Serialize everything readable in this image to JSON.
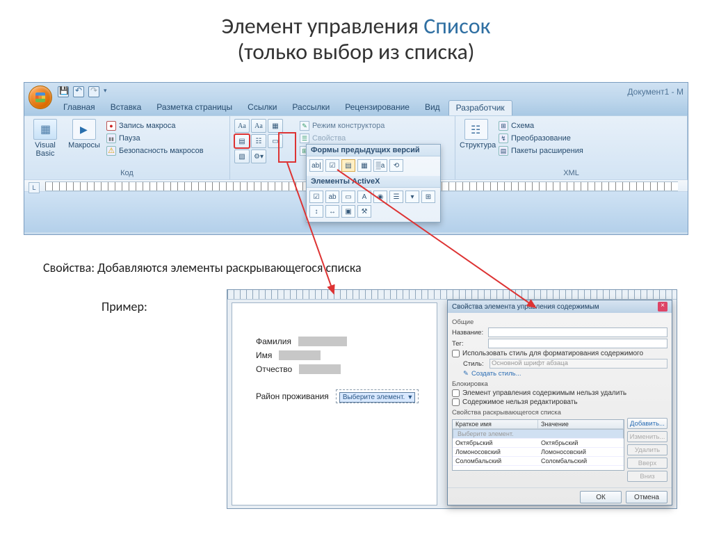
{
  "slide": {
    "title_plain": "Элемент управления ",
    "title_accent": "Список",
    "subtitle": "(только выбор из списка)"
  },
  "word": {
    "doc_title": "Документ1 - M",
    "tabs": [
      "Главная",
      "Вставка",
      "Разметка страницы",
      "Ссылки",
      "Рассылки",
      "Рецензирование",
      "Вид",
      "Разработчик"
    ],
    "active_tab_index": 7,
    "groups": {
      "code": {
        "label": "Код",
        "vb": "Visual Basic",
        "macros": "Макросы",
        "rec": "Запись макроса",
        "pause": "Пауза",
        "security": "Безопасность макросов"
      },
      "controls": {
        "design_mode": "Режим конструктора",
        "properties": "Свойства",
        "group": "Группировать"
      },
      "xml": {
        "label": "XML",
        "structure": "Структура",
        "schema": "Схема",
        "transform": "Преобразование",
        "packs": "Пакеты расширения"
      }
    },
    "legacy_panel": {
      "hdr1": "Формы предыдущих версий",
      "hdr2": "Элементы ActiveX"
    }
  },
  "body": {
    "prop_line": "Свойства: Добавляются  элементы раскрывающегося списка",
    "example": "Пример:",
    "form": {
      "lastname": "Фамилия",
      "firstname": "Имя",
      "patronymic": "Отчество",
      "region": "Район проживания",
      "dd_text": "Выберите элемент."
    }
  },
  "dialog": {
    "title": "Свойства элемента управления содержимым",
    "general": "Общие",
    "name": "Название:",
    "tag": "Тег:",
    "use_style": "Использовать стиль для форматирования содержимого",
    "style_lbl": "Стиль:",
    "style_val": "Основной шрифт абзаца",
    "create_style": "Создать стиль...",
    "lock": "Блокировка",
    "lock_del": "Элемент управления содержимым нельзя удалить",
    "lock_edit": "Содержимое нельзя редактировать",
    "ddprops": "Свойства раскрывающегося списка",
    "col1": "Краткое имя",
    "col2": "Значение",
    "rows": [
      {
        "name": "Выберите элемент.",
        "val": ""
      },
      {
        "name": "Октябрьский",
        "val": "Октябрьский"
      },
      {
        "name": "Ломоносовский",
        "val": "Ломоносовский"
      },
      {
        "name": "Соломбальский",
        "val": "Соломбальский"
      }
    ],
    "btns": {
      "add": "Добавить...",
      "edit": "Изменить...",
      "del": "Удалить",
      "up": "Вверх",
      "down": "Вниз"
    },
    "ok": "ОК",
    "cancel": "Отмена"
  }
}
